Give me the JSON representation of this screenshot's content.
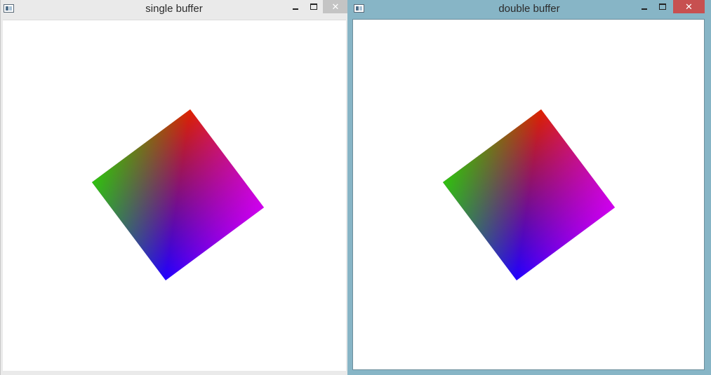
{
  "windows": [
    {
      "title": "single buffer",
      "active": false,
      "controls": {
        "minimize": "",
        "maximize": "",
        "close": "✕"
      },
      "colors": {
        "frame": "#eaeaea",
        "close_bg": "#c4c4c4"
      },
      "shape": {
        "type": "gradient-square",
        "corner_colors": [
          "#ff0000",
          "#00ff00",
          "#0000ff",
          "#ff00ff"
        ]
      }
    },
    {
      "title": "double buffer",
      "active": true,
      "controls": {
        "minimize": "",
        "maximize": "",
        "close": "✕"
      },
      "colors": {
        "frame": "#87b5c6",
        "close_bg": "#c75050"
      },
      "shape": {
        "type": "gradient-square",
        "corner_colors": [
          "#ff0000",
          "#00ff00",
          "#0000ff",
          "#ff00ff"
        ]
      }
    }
  ]
}
